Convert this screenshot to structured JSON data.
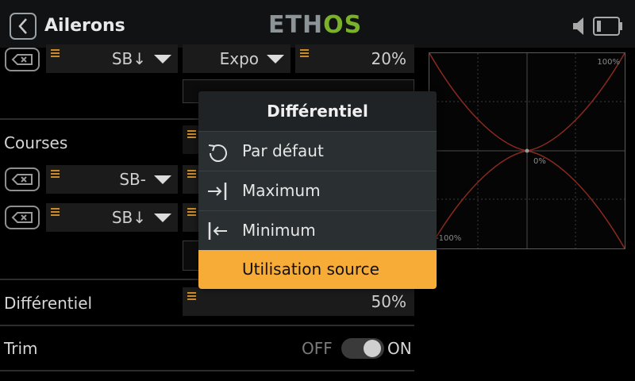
{
  "header": {
    "title": "Ailerons",
    "logo_left": "ETH",
    "logo_right": "OS"
  },
  "top_row": {
    "source": "SB↓",
    "curve_type": "Expo",
    "curve_value": "20%"
  },
  "sections": {
    "courses_label": "Courses",
    "differential_label": "Différentiel",
    "differential_value": "50%",
    "trim_label": "Trim",
    "trim_off": "OFF",
    "trim_on": "ON"
  },
  "courses_rows": [
    {
      "source": "SB-"
    },
    {
      "source": "SB↓"
    }
  ],
  "graph": {
    "label_top": "100%",
    "label_center": "0%",
    "label_bottom": "-100%",
    "curve_color": "#8a2a1e",
    "grid_color": "#3a3a3a"
  },
  "menu": {
    "title": "Différentiel",
    "items": [
      {
        "label": "Par défaut",
        "icon": "reset-icon"
      },
      {
        "label": "Maximum",
        "icon": "arrow-right-bar-icon"
      },
      {
        "label": "Minimum",
        "icon": "arrow-left-bar-icon"
      },
      {
        "label": "Utilisation source",
        "icon": ""
      }
    ],
    "selected_index": 3
  },
  "colors": {
    "accent": "#f7ac38",
    "bars": "#c88a2c",
    "logo_green": "#7bb12a"
  }
}
